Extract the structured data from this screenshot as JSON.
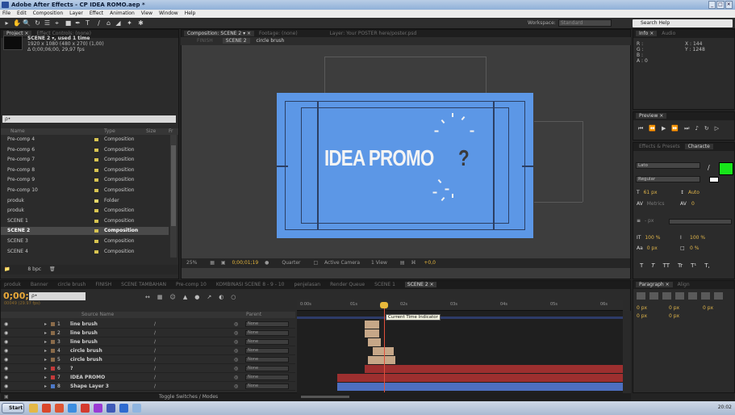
{
  "window": {
    "title": "Adobe After Effects - CP IDEA ROMO.aep *",
    "controls": [
      "_",
      "□",
      "✕"
    ]
  },
  "menu": [
    "File",
    "Edit",
    "Composition",
    "Layer",
    "Effect",
    "Animation",
    "View",
    "Window",
    "Help"
  ],
  "toolbar": {
    "workspace_label": "Workspace:",
    "workspace_value": "Standard",
    "search_placeholder": "Search Help"
  },
  "project": {
    "tab": "Project ×",
    "tab2": "Effect Controls: (none)",
    "selected_name": "SCENE 2 ▾, used 1 time",
    "selected_size": "1920 x 1080 (480 x 270) (1,00)",
    "selected_duration": "Δ 0;00;06;00, 29,97 fps",
    "search_placeholder": "ρ•",
    "col_name": "Name",
    "col_type": "Type",
    "col_size": "Size",
    "col_fr": "Fr",
    "items": [
      {
        "name": "Pre-comp 4",
        "type": "Composition",
        "color": "#d8c451"
      },
      {
        "name": "Pre-comp 6",
        "type": "Composition",
        "color": "#d8c451"
      },
      {
        "name": "Pre-comp 7",
        "type": "Composition",
        "color": "#d8c451"
      },
      {
        "name": "Pre-comp 8",
        "type": "Composition",
        "color": "#d8c451"
      },
      {
        "name": "Pre-comp 9",
        "type": "Composition",
        "color": "#d8c451"
      },
      {
        "name": "Pre-comp 10",
        "type": "Composition",
        "color": "#d8c451"
      },
      {
        "name": "produk",
        "type": "Folder",
        "color": "#e8d86a"
      },
      {
        "name": "produk",
        "type": "Composition",
        "color": "#d8c451"
      },
      {
        "name": "SCENE 1",
        "type": "Composition",
        "color": "#d8c451"
      },
      {
        "name": "SCENE 2",
        "type": "Composition",
        "color": "#d8c451",
        "selected": true
      },
      {
        "name": "SCENE 3",
        "type": "Composition",
        "color": "#d8c451"
      },
      {
        "name": "SCENE 4",
        "type": "Composition",
        "color": "#d8c451"
      }
    ],
    "footer_bpc": "8 bpc"
  },
  "composition": {
    "tab": "Composition: SCENE 2 ▾ ×",
    "tab2": "Footage: (none)",
    "tab3": "Layer: Your POSTER here/poster.psd",
    "breadcrumb_1": "FINISH",
    "breadcrumb_2": "SCENE 2",
    "breadcrumb_3": "circle brush",
    "canvas_text": "IDEA PROMO",
    "canvas_text_2": "?",
    "footer": {
      "zoom": "25%",
      "timecode": "0;00;01;19",
      "resolution": "Quarter",
      "camera": "Active Camera",
      "view": "1 View",
      "exposure": "+0,0"
    }
  },
  "info_panel": {
    "tab": "Info ×",
    "tab2": "Audio",
    "r": "R :",
    "g": "G :",
    "b": "B :",
    "a": "A : 0",
    "x": "X : 144",
    "y": "Y : 1248"
  },
  "preview_panel": {
    "tab": "Preview ×"
  },
  "character_panel": {
    "tab": "Effects & Presets",
    "tab2": "Characte",
    "font": "Lato",
    "style": "Regular",
    "size": "61 px",
    "leading": "Auto",
    "tracking_label": "Metrics",
    "tracking": "0",
    "stroke": "- px",
    "v_scale": "100 %",
    "h_scale": "100 %",
    "baseline": "0 px",
    "tsume": "0 %",
    "style_buttons": [
      "T",
      "T",
      "TT",
      "Tr",
      "T¹",
      "T,"
    ],
    "fill_color": "#17e51a"
  },
  "paragraph_panel": {
    "tab": "Paragraph ×",
    "tab2": "Align",
    "indent_1": "0 px",
    "indent_2": "0 px",
    "indent_3": "0 px",
    "space_1": "0 px",
    "space_2": "0 px"
  },
  "timeline": {
    "tabs": [
      {
        "label": "produk"
      },
      {
        "label": "Banner"
      },
      {
        "label": "circle brush"
      },
      {
        "label": "FINISH"
      },
      {
        "label": "SCENE TAMBAHAN"
      },
      {
        "label": "Pre-comp 10"
      },
      {
        "label": "KOMBINASI SCENE 8 - 9 - 10"
      },
      {
        "label": "penjelasan"
      },
      {
        "label": "Render Queue"
      },
      {
        "label": "SCENE 1"
      },
      {
        "label": "SCENE 2 ×",
        "active": true
      }
    ],
    "timecode": "0;00;01;19",
    "timecode_sub": "00049 (29.97 fps)",
    "search_placeholder": "ρ•",
    "col_source": "Source Name",
    "col_parent": "Parent",
    "ruler": [
      "0:00s",
      "01s",
      "02s",
      "03s",
      "04s",
      "05s",
      "06s"
    ],
    "tooltip": "Current Time Indicator",
    "footer_toggle": "Toggle Switches / Modes",
    "layers": [
      {
        "num": "1",
        "name": "line brush",
        "label_color": "#8a6b4a",
        "parent": "None"
      },
      {
        "num": "2",
        "name": "line brush",
        "label_color": "#8a6b4a",
        "parent": "None"
      },
      {
        "num": "3",
        "name": "line brush",
        "label_color": "#8a6b4a",
        "parent": "None"
      },
      {
        "num": "4",
        "name": "circle brush",
        "label_color": "#8a6b4a",
        "parent": "None"
      },
      {
        "num": "5",
        "name": "circle brush",
        "label_color": "#8a6b4a",
        "parent": "None"
      },
      {
        "num": "6",
        "name": "?",
        "label_color": "#c43a3a",
        "parent": "None"
      },
      {
        "num": "7",
        "name": "IDEA PROMO",
        "label_color": "#c43a3a",
        "parent": "None"
      },
      {
        "num": "8",
        "name": "Shape Layer 3",
        "label_color": "#4d79c7",
        "parent": "None"
      }
    ]
  },
  "taskbar": {
    "start": "Start",
    "clock": "20:02"
  }
}
